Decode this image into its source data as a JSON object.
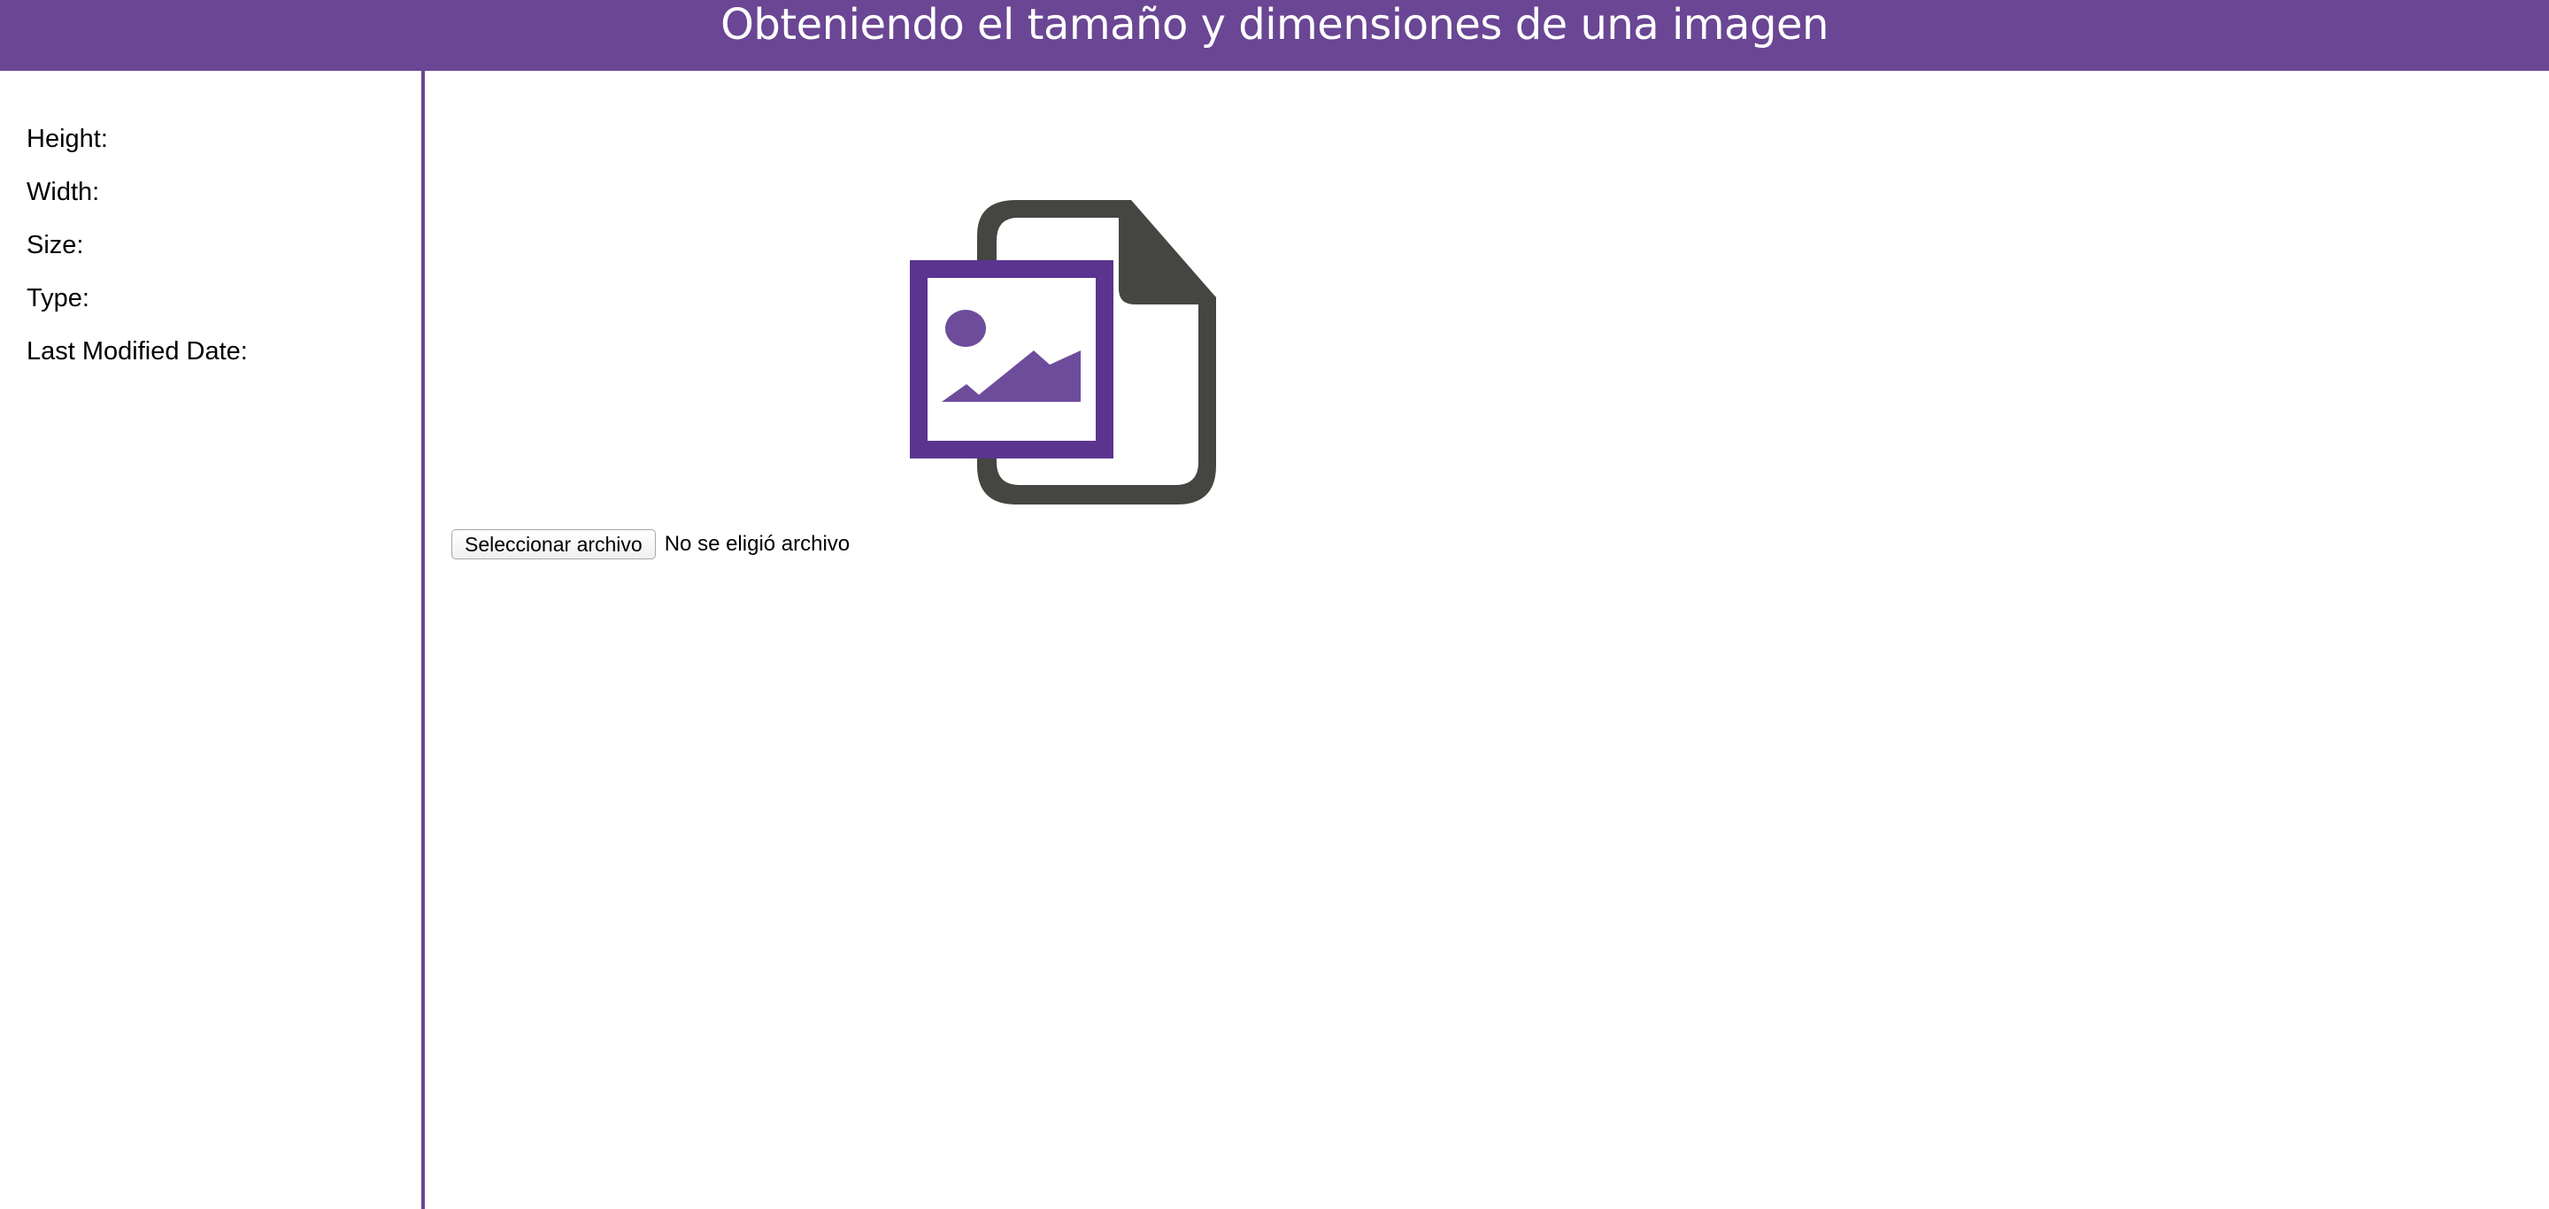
{
  "header": {
    "title": "Obteniendo el tamaño y dimensiones de una imagen",
    "background_color": "#6a4694"
  },
  "sidebar": {
    "fields": [
      {
        "label": "Height:",
        "value": ""
      },
      {
        "label": "Width:",
        "value": ""
      },
      {
        "label": "Size:",
        "value": ""
      },
      {
        "label": "Type:",
        "value": ""
      },
      {
        "label": "Last Modified Date:",
        "value": ""
      }
    ]
  },
  "main": {
    "preview_icon": "image-file-icon",
    "file_input": {
      "button_label": "Seleccionar archivo",
      "status_text": "No se eligió archivo"
    }
  },
  "colors": {
    "accent": "#6a4694",
    "icon_dark": "#454542",
    "icon_purple": "#5b3490"
  }
}
